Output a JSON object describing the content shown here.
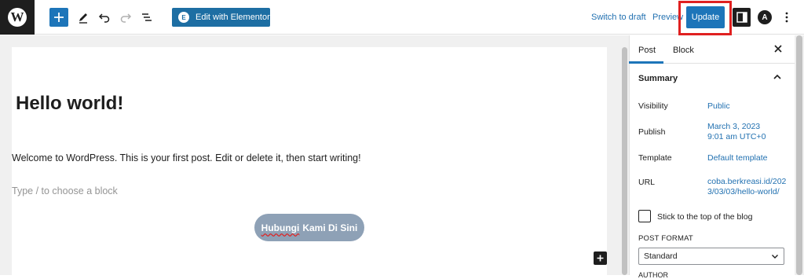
{
  "toolbar": {
    "logo_letter": "W",
    "elementor_icon": "E",
    "elementor_label": "Edit with Elementor",
    "switch_to_draft": "Switch to draft",
    "preview": "Preview",
    "update": "Update",
    "astra_letter": "A",
    "icons": [
      "wordpress-logo-icon",
      "plus-icon",
      "pencil-icon",
      "undo-icon",
      "redo-icon",
      "list-view-icon",
      "settings-panel-icon",
      "astra-icon",
      "more-vertical-icon"
    ]
  },
  "editor": {
    "title": "Hello world!",
    "paragraph": "Welcome to WordPress. This is your first post. Edit or delete it, then start writing!",
    "placeholder": "Type / to choose a block",
    "button_word1": "Hubungi",
    "button_rest": "Kami Di Sini"
  },
  "sidebar": {
    "tabs": [
      "Post",
      "Block"
    ],
    "active_tab": "Post",
    "summary_title": "Summary",
    "rows": [
      {
        "label": "Visibility",
        "value": "Public"
      },
      {
        "label": "Publish",
        "value": "March 3, 2023",
        "value2": "9:01 am UTC+0"
      },
      {
        "label": "Template",
        "value": "Default template"
      },
      {
        "label": "URL",
        "value": "coba.berkreasi.id/202",
        "value2": "3/03/03/hello-world/"
      }
    ],
    "stick_label": "Stick to the top of the blog",
    "stick_checked": false,
    "format_label": "POST FORMAT",
    "format_value": "Standard",
    "author_peek": "AUTHOR"
  },
  "colors": {
    "primary": "#1d75b9",
    "highlight": "#e02020",
    "link": "#2271b1",
    "button_pill": "#8ea1b6"
  }
}
